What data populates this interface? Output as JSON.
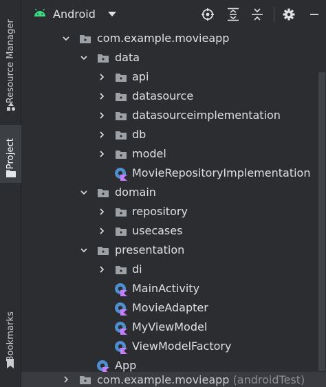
{
  "sidebar": {
    "resource_manager": "Resource Manager",
    "project": "Project",
    "bookmarks": "Bookmarks"
  },
  "header": {
    "title": "Android",
    "icons": [
      "android-icon",
      "chevron-down-icon",
      "locate-icon",
      "expand-all-icon",
      "collapse-all-icon",
      "gear-icon",
      "minimize-icon"
    ]
  },
  "tree": {
    "root": "com.example.movieapp",
    "data": "data",
    "api": "api",
    "datasource": "datasource",
    "datasourceimplementation": "datasourceimplementation",
    "db": "db",
    "model": "model",
    "movie_repo_impl": "MovieRepositoryImplementation",
    "domain": "domain",
    "repository": "repository",
    "usecases": "usecases",
    "presentation": "presentation",
    "di": "di",
    "main_activity": "MainActivity",
    "movie_adapter": "MovieAdapter",
    "my_view_model": "MyViewModel",
    "view_model_factory": "ViewModelFactory",
    "app": "App",
    "android_test_root": "com.example.movieapp",
    "android_test_suffix": "(androidTest)"
  },
  "colors": {
    "background": "#2b2d30",
    "text": "#dfe1e5",
    "folder": "#9ea1a6",
    "kotlin_circle": "#4f8fd0",
    "kotlin_mark": "#c77dff",
    "android_green": "#3ddc84"
  }
}
